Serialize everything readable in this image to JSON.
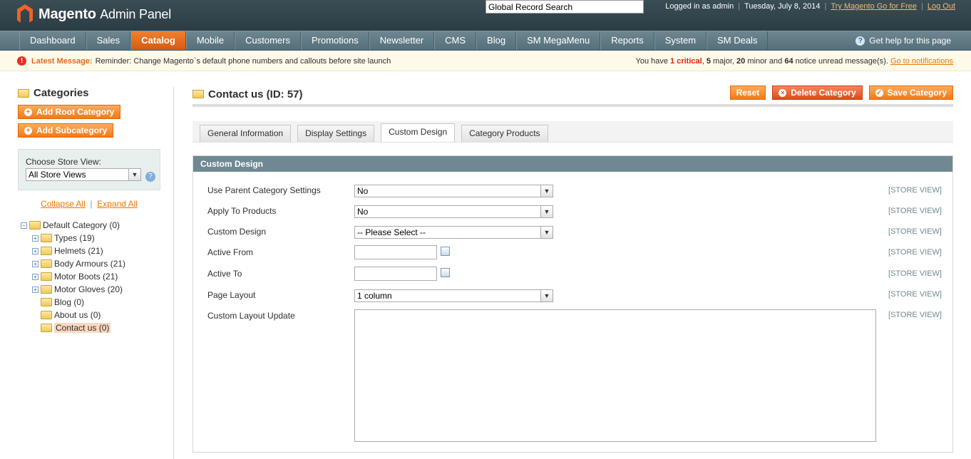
{
  "header": {
    "logo_brand": "Magento",
    "logo_suffix": "Admin Panel",
    "search_value": "Global Record Search",
    "logged_in": "Logged in as admin",
    "date": "Tuesday, July 8, 2014",
    "try_link": "Try Magento Go for Free",
    "logout": "Log Out"
  },
  "nav": {
    "items": [
      "Dashboard",
      "Sales",
      "Catalog",
      "Mobile",
      "Customers",
      "Promotions",
      "Newsletter",
      "CMS",
      "Blog",
      "SM MegaMenu",
      "Reports",
      "System",
      "SM Deals"
    ],
    "active": "Catalog",
    "help": "Get help for this page"
  },
  "message": {
    "label": "Latest Message:",
    "text": "Reminder: Change Magento`s default phone numbers and callouts before site launch",
    "count_prefix": "You have",
    "critical": "1 critical",
    "major": "5",
    "major_label": "major,",
    "minor": "20",
    "minor_label": "minor and",
    "notice": "64",
    "notice_label": "notice unread message(s).",
    "link": "Go to notifications"
  },
  "sidebar": {
    "title": "Categories",
    "add_root": "Add Root Category",
    "add_sub": "Add Subcategory",
    "store_label": "Choose Store View:",
    "store_value": "All Store Views",
    "collapse_all": "Collapse All",
    "expand_all": "Expand All",
    "tree_root": "Default Category (0)",
    "tree": [
      {
        "label": "Types (19)",
        "expandable": true
      },
      {
        "label": "Helmets (21)",
        "expandable": true
      },
      {
        "label": "Body Armours (21)",
        "expandable": true
      },
      {
        "label": "Motor Boots (21)",
        "expandable": true
      },
      {
        "label": "Motor Gloves (20)",
        "expandable": true
      },
      {
        "label": "Blog (0)",
        "expandable": false
      },
      {
        "label": "About us (0)",
        "expandable": false
      },
      {
        "label": "Contact us (0)",
        "expandable": false,
        "selected": true
      }
    ]
  },
  "main": {
    "title": "Contact us (ID: 57)",
    "reset": "Reset",
    "delete": "Delete Category",
    "save": "Save Category",
    "tabs": [
      "General Information",
      "Display Settings",
      "Custom Design",
      "Category Products"
    ],
    "active_tab": "Custom Design",
    "section_title": "Custom Design",
    "fields": {
      "use_parent_label": "Use Parent Category Settings",
      "use_parent_value": "No",
      "apply_label": "Apply To Products",
      "apply_value": "No",
      "design_label": "Custom Design",
      "design_value": "-- Please Select --",
      "from_label": "Active From",
      "to_label": "Active To",
      "layout_label": "Page Layout",
      "layout_value": "1 column",
      "update_label": "Custom Layout Update",
      "scope": "[STORE VIEW]"
    }
  }
}
